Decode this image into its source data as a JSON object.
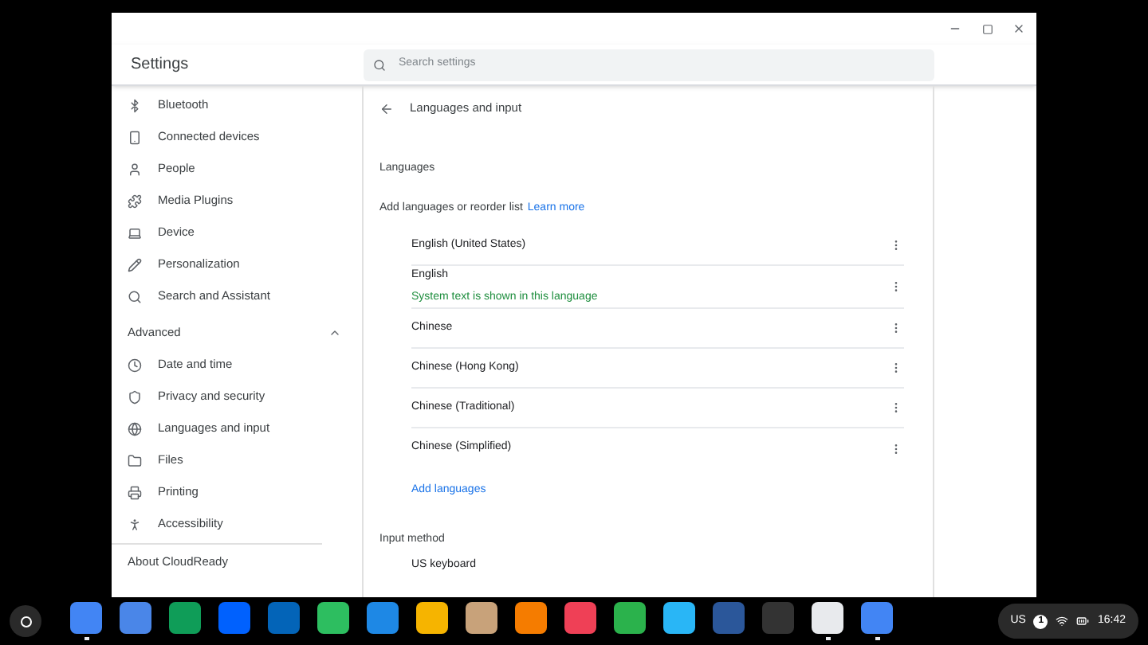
{
  "header": {
    "title": "Settings",
    "search": {
      "placeholder": "Search settings"
    }
  },
  "sidebar": {
    "items": [
      {
        "label": "Bluetooth"
      },
      {
        "label": "Connected devices"
      },
      {
        "label": "People"
      },
      {
        "label": "Media Plugins"
      },
      {
        "label": "Device"
      },
      {
        "label": "Personalization"
      },
      {
        "label": "Search and Assistant"
      }
    ],
    "advanced": {
      "label": "Advanced",
      "expanded": true,
      "items": [
        {
          "label": "Date and time"
        },
        {
          "label": "Privacy and security"
        },
        {
          "label": "Languages and input"
        },
        {
          "label": "Files"
        },
        {
          "label": "Printing"
        },
        {
          "label": "Accessibility"
        }
      ]
    },
    "footer": "About CloudReady"
  },
  "page": {
    "title": "Languages and input",
    "languages_heading": "Languages",
    "intro": "Add languages or reorder list",
    "learn_more": "Learn more",
    "languages": [
      {
        "name": "English (United States)"
      },
      {
        "name": "English",
        "note": "System text is shown in this language"
      },
      {
        "name": "Chinese"
      },
      {
        "name": "Chinese (Hong Kong)"
      },
      {
        "name": "Chinese (Traditional)"
      },
      {
        "name": "Chinese (Simplified)"
      }
    ],
    "add_languages": "Add languages",
    "input_heading": "Input method",
    "input_methods": [
      {
        "name": "US keyboard"
      }
    ]
  },
  "shelf": {
    "apps": [
      {
        "color": "#4285f4",
        "running": true
      },
      {
        "color": "#4a86e8",
        "running": false
      },
      {
        "color": "#0f9d58",
        "running": false
      },
      {
        "color": "#0061fe",
        "running": false
      },
      {
        "color": "#0364b8",
        "running": false
      },
      {
        "color": "#2dbe60",
        "running": false
      },
      {
        "color": "#1e88e5",
        "running": false
      },
      {
        "color": "#f6b400",
        "running": false
      },
      {
        "color": "#c8a27a",
        "running": false
      },
      {
        "color": "#f57c00",
        "running": false
      },
      {
        "color": "#ef4056",
        "running": false
      },
      {
        "color": "#2bb24c",
        "running": false
      },
      {
        "color": "#29b6f6",
        "running": false
      },
      {
        "color": "#2b579a",
        "running": false
      },
      {
        "color": "#333333",
        "running": false
      },
      {
        "color": "#e8eaed",
        "running": true
      },
      {
        "color": "#4285f4",
        "running": true
      }
    ],
    "status": {
      "ime": "US",
      "badge": "1",
      "time": "16:42"
    }
  }
}
